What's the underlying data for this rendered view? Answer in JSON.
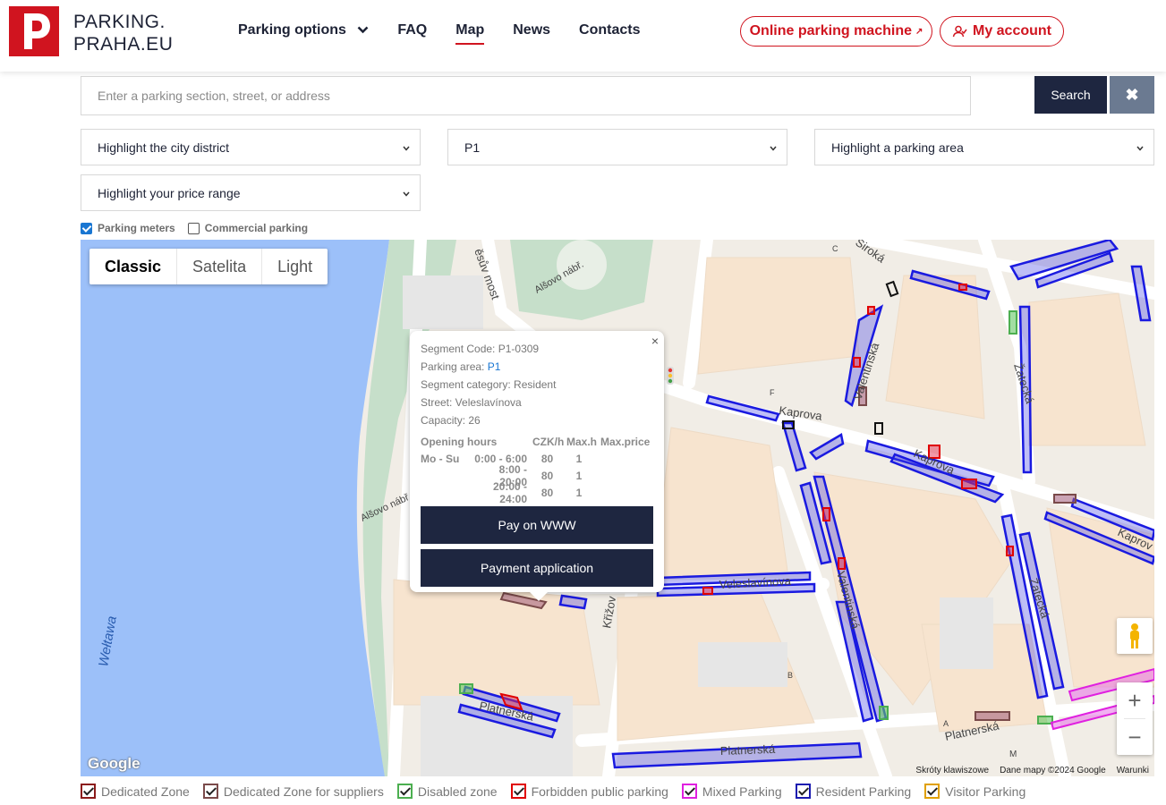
{
  "header": {
    "logo_line1": "PARKING.",
    "logo_line2": "PRAHA.EU",
    "nav": [
      {
        "label": "Parking options"
      },
      {
        "label": "FAQ"
      },
      {
        "label": "Map"
      },
      {
        "label": "News"
      },
      {
        "label": "Contacts"
      }
    ],
    "active_nav": "Map",
    "online_machine_label": "Online parking machine",
    "account_label": "My account"
  },
  "search": {
    "placeholder": "Enter a parking section, street, or address",
    "value": "",
    "search_label": "Search",
    "clear_label": "✖"
  },
  "filters": {
    "district": "Highlight the city district",
    "zone": "P1",
    "area": "Highlight a parking area",
    "price": "Highlight your price range"
  },
  "layers": [
    {
      "label": "Parking meters",
      "checked": true
    },
    {
      "label": "Commercial parking",
      "checked": false
    }
  ],
  "map": {
    "map_types": [
      "Classic",
      "Satelita",
      "Light"
    ],
    "selected_type": "Classic",
    "street_labels": {
      "manesuv_most": "ěsův most",
      "alsovo_nabr_top": "Alšovo nábř.",
      "alsovo_nabr_left": "Alšovo nábř.",
      "siroka": "Široká",
      "valentinska_top": "Valentinská",
      "zatecka": "Žatecká",
      "kaprova_1": "Kaprova",
      "kaprova_2": "Kaprova",
      "kaprova_3": "Kaprov",
      "krizovnicka": "Křižov",
      "veleslavinova": "Veleslavínova",
      "valentinska_mid": "Valentinská",
      "zatecka_low": "Žatecká",
      "platnerska_1": "Platnerská",
      "platnerska_2": "Platnerská",
      "platnerska_3": "Platnerská",
      "weltawa": "Wełtawa",
      "letter_c": "C",
      "letter_f": "F",
      "letter_b": "B",
      "letter_a": "A",
      "letter_m": "M"
    },
    "google_label": "Google",
    "attribution": [
      "Skróty klawiszowe",
      "Dane mapy ©2024 Google",
      "Warunki"
    ],
    "zoom_in": "+",
    "zoom_out": "−"
  },
  "popup": {
    "segment_code": "Segment Code: P1-0309",
    "parking_area_label": "Parking area: ",
    "parking_area_value": "P1",
    "segment_category": "Segment category: Resident",
    "street": "Street: Veleslavínova",
    "capacity": "Capacity: 26",
    "hours_header": [
      "Opening hours",
      "CZK/h",
      "Max.h",
      "Max.price"
    ],
    "hours_rows": [
      {
        "days": "Mo - Su",
        "time": "0:00 - 6:00",
        "czk": "80",
        "maxh": "1",
        "maxprice": ""
      },
      {
        "days": "",
        "time": "8:00 - 20:00",
        "czk": "80",
        "maxh": "1",
        "maxprice": ""
      },
      {
        "days": "",
        "time": "20:00 - 24:00",
        "czk": "80",
        "maxh": "1",
        "maxprice": ""
      }
    ],
    "pay_www_label": "Pay on WWW",
    "payment_app_label": "Payment application",
    "close_label": "×"
  },
  "legend": [
    {
      "label": "Dedicated Zone",
      "color": "#8b1a1a"
    },
    {
      "label": "Dedicated Zone for suppliers",
      "color": "#7a4a4a"
    },
    {
      "label": "Disabled zone",
      "color": "#4caf50"
    },
    {
      "label": "Forbidden public parking",
      "color": "#e00000"
    },
    {
      "label": "Mixed Parking",
      "color": "#e020e0"
    },
    {
      "label": "Resident Parking",
      "color": "#1a1ab0"
    },
    {
      "label": "Visitor Parking",
      "color": "#e0a000"
    }
  ],
  "colors": {
    "brand_red": "#d0141f",
    "navy": "#1e2640",
    "water": "#9cc0f9",
    "park_green": "#c8e0cc",
    "resident_blue": "#1a1ae0"
  }
}
